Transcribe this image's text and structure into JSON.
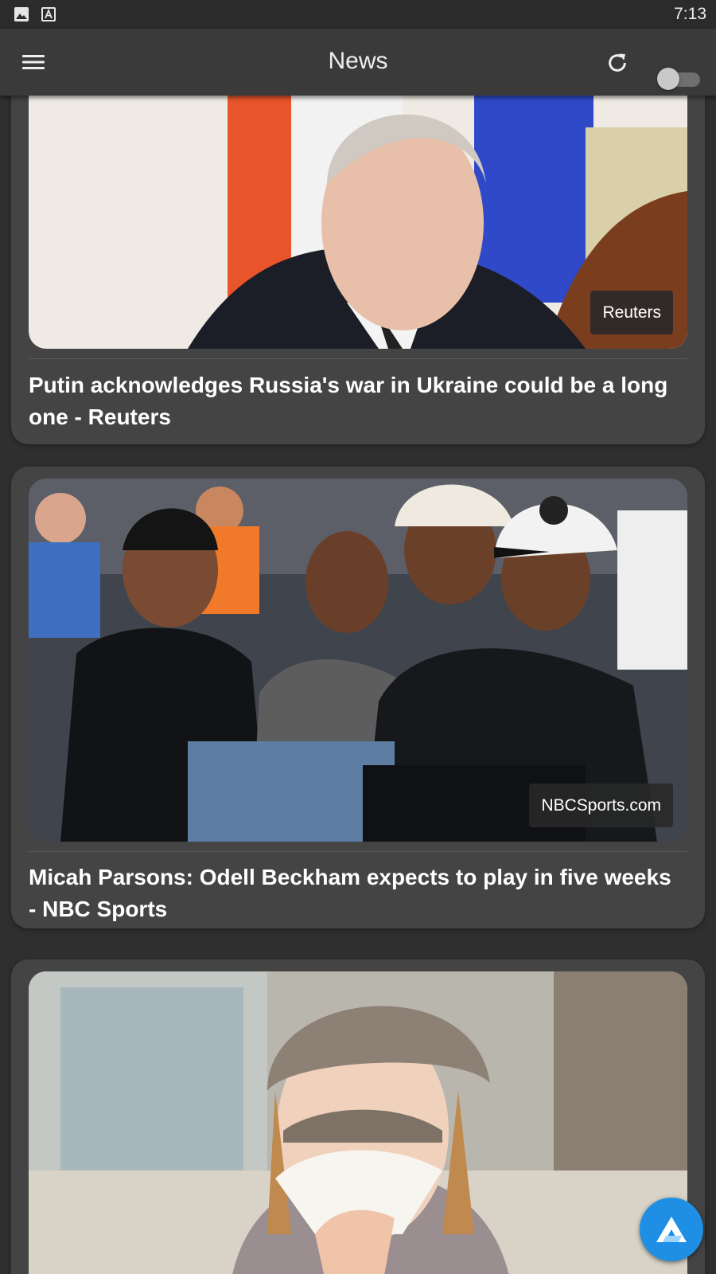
{
  "status_bar": {
    "time": "7:13",
    "icons": [
      "image-icon",
      "text-a-icon"
    ]
  },
  "app_bar": {
    "title": "News",
    "menu_icon": "hamburger-menu-icon",
    "refresh_icon": "refresh-icon",
    "toggle": {
      "state": "off"
    }
  },
  "articles": [
    {
      "source": "Reuters",
      "headline": "Putin acknowledges Russia's war in Ukraine could be a long one - Reuters"
    },
    {
      "source": "NBCSports.com",
      "headline": "Micah Parsons: Odell Beckham expects to play in five weeks - NBC Sports"
    },
    {
      "source": "",
      "headline": ""
    }
  ],
  "fab": {
    "icon": "app-logo-icon"
  },
  "colors": {
    "background": "#2f2f2f",
    "app_bar": "#3a3a3a",
    "card": "#444444",
    "fab": "#1f8fe6"
  }
}
